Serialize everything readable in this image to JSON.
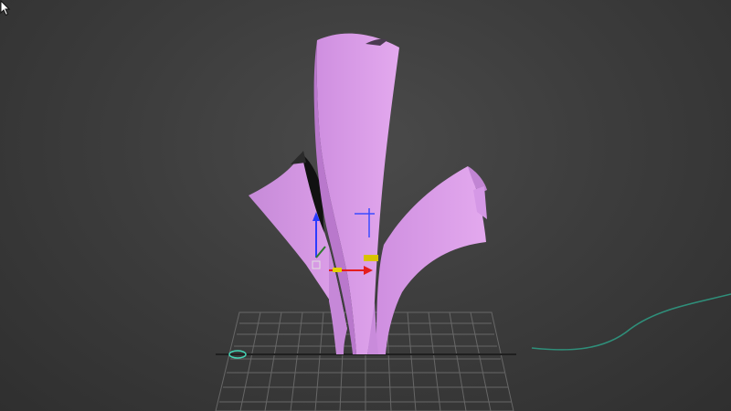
{
  "viewport": {
    "view": "perspective",
    "background_color": "#3c3c3c",
    "grid_color": "#6f6f6f",
    "object_color": "#d79be6",
    "object_shadow_color": "#a36cb6",
    "spline_color": "#2f8f7a"
  },
  "gizmo": {
    "type": "move-transform-gizmo",
    "x_axis_color": "#e51d1d",
    "y_axis_color": "#2f7a2f",
    "z_axis_color": "#2a3cff",
    "plane_color": "#e3d000"
  },
  "icons": {
    "cursor": "arrow-cursor-icon"
  }
}
